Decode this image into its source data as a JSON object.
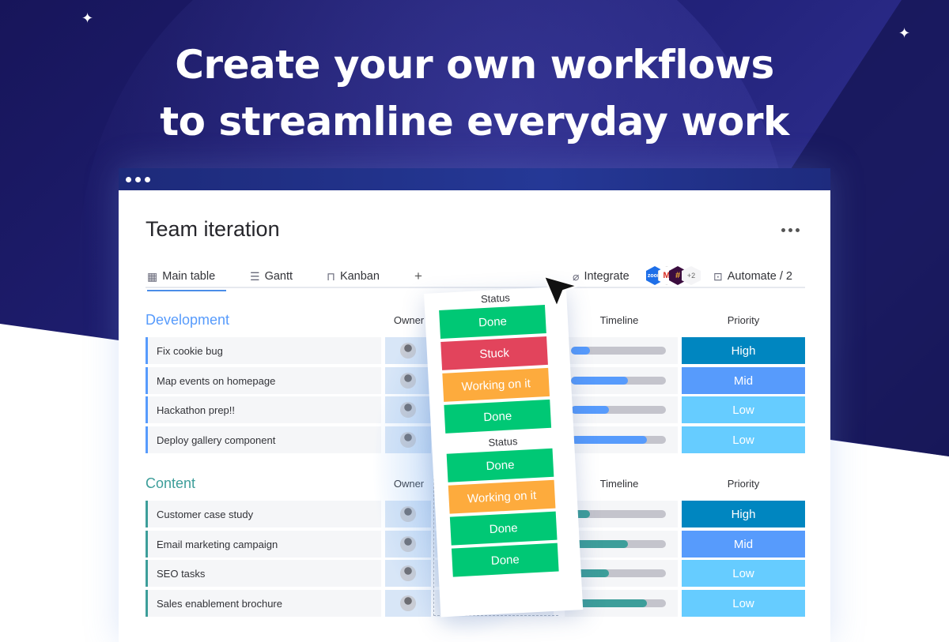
{
  "headline": {
    "line1": "Create your own workflows",
    "line2": "to streamline everyday work"
  },
  "board": {
    "title": "Team iteration",
    "menu_icon": "more-horizontal-icon",
    "tabs": [
      {
        "label": "Main table",
        "icon": "table-icon",
        "active": true
      },
      {
        "label": "Gantt",
        "icon": "gantt-icon",
        "active": false
      },
      {
        "label": "Kanban",
        "icon": "kanban-icon",
        "active": false
      },
      {
        "label": "+",
        "icon": "plus-icon",
        "active": false
      }
    ],
    "integrate": {
      "label": "Integrate",
      "icon": "plug-icon",
      "apps": [
        "zoom",
        "gmail",
        "slack"
      ],
      "more_count": "+2"
    },
    "automate": {
      "label": "Automate / 2",
      "icon": "robot-icon"
    }
  },
  "columns": {
    "owner": "Owner",
    "status": "Status",
    "timeline": "Timeline",
    "priority": "Priority"
  },
  "groups": [
    {
      "title": "Development",
      "color": "#579bfc",
      "rows": [
        {
          "name": "Fix cookie bug",
          "status": "Done",
          "timeline_progress": 0.2,
          "priority": "High"
        },
        {
          "name": "Map events on homepage",
          "status": "Stuck",
          "timeline_progress": 0.6,
          "priority": "Mid"
        },
        {
          "name": "Hackathon prep!!",
          "status": "Working on it",
          "timeline_progress": 0.4,
          "priority": "Low"
        },
        {
          "name": "Deploy gallery component",
          "status": "Done",
          "timeline_progress": 0.8,
          "priority": "Low"
        }
      ]
    },
    {
      "title": "Content",
      "color": "#3d9e9a",
      "rows": [
        {
          "name": "Customer case study",
          "status": "Done",
          "timeline_progress": 0.2,
          "priority": "High"
        },
        {
          "name": "Email marketing campaign",
          "status": "Working on it",
          "timeline_progress": 0.6,
          "priority": "Mid"
        },
        {
          "name": "SEO tasks",
          "status": "Done",
          "timeline_progress": 0.4,
          "priority": "Low"
        },
        {
          "name": "Sales enablement brochure",
          "status": "Done",
          "timeline_progress": 0.8,
          "priority": "Low"
        }
      ]
    }
  ],
  "status_colors": {
    "Done": "#00c875",
    "Stuck": "#e2445c",
    "Working on it": "#fdab3d"
  },
  "priority_colors": {
    "High": "#0086c0",
    "Mid": "#579bfc",
    "Low": "#66ccff"
  }
}
